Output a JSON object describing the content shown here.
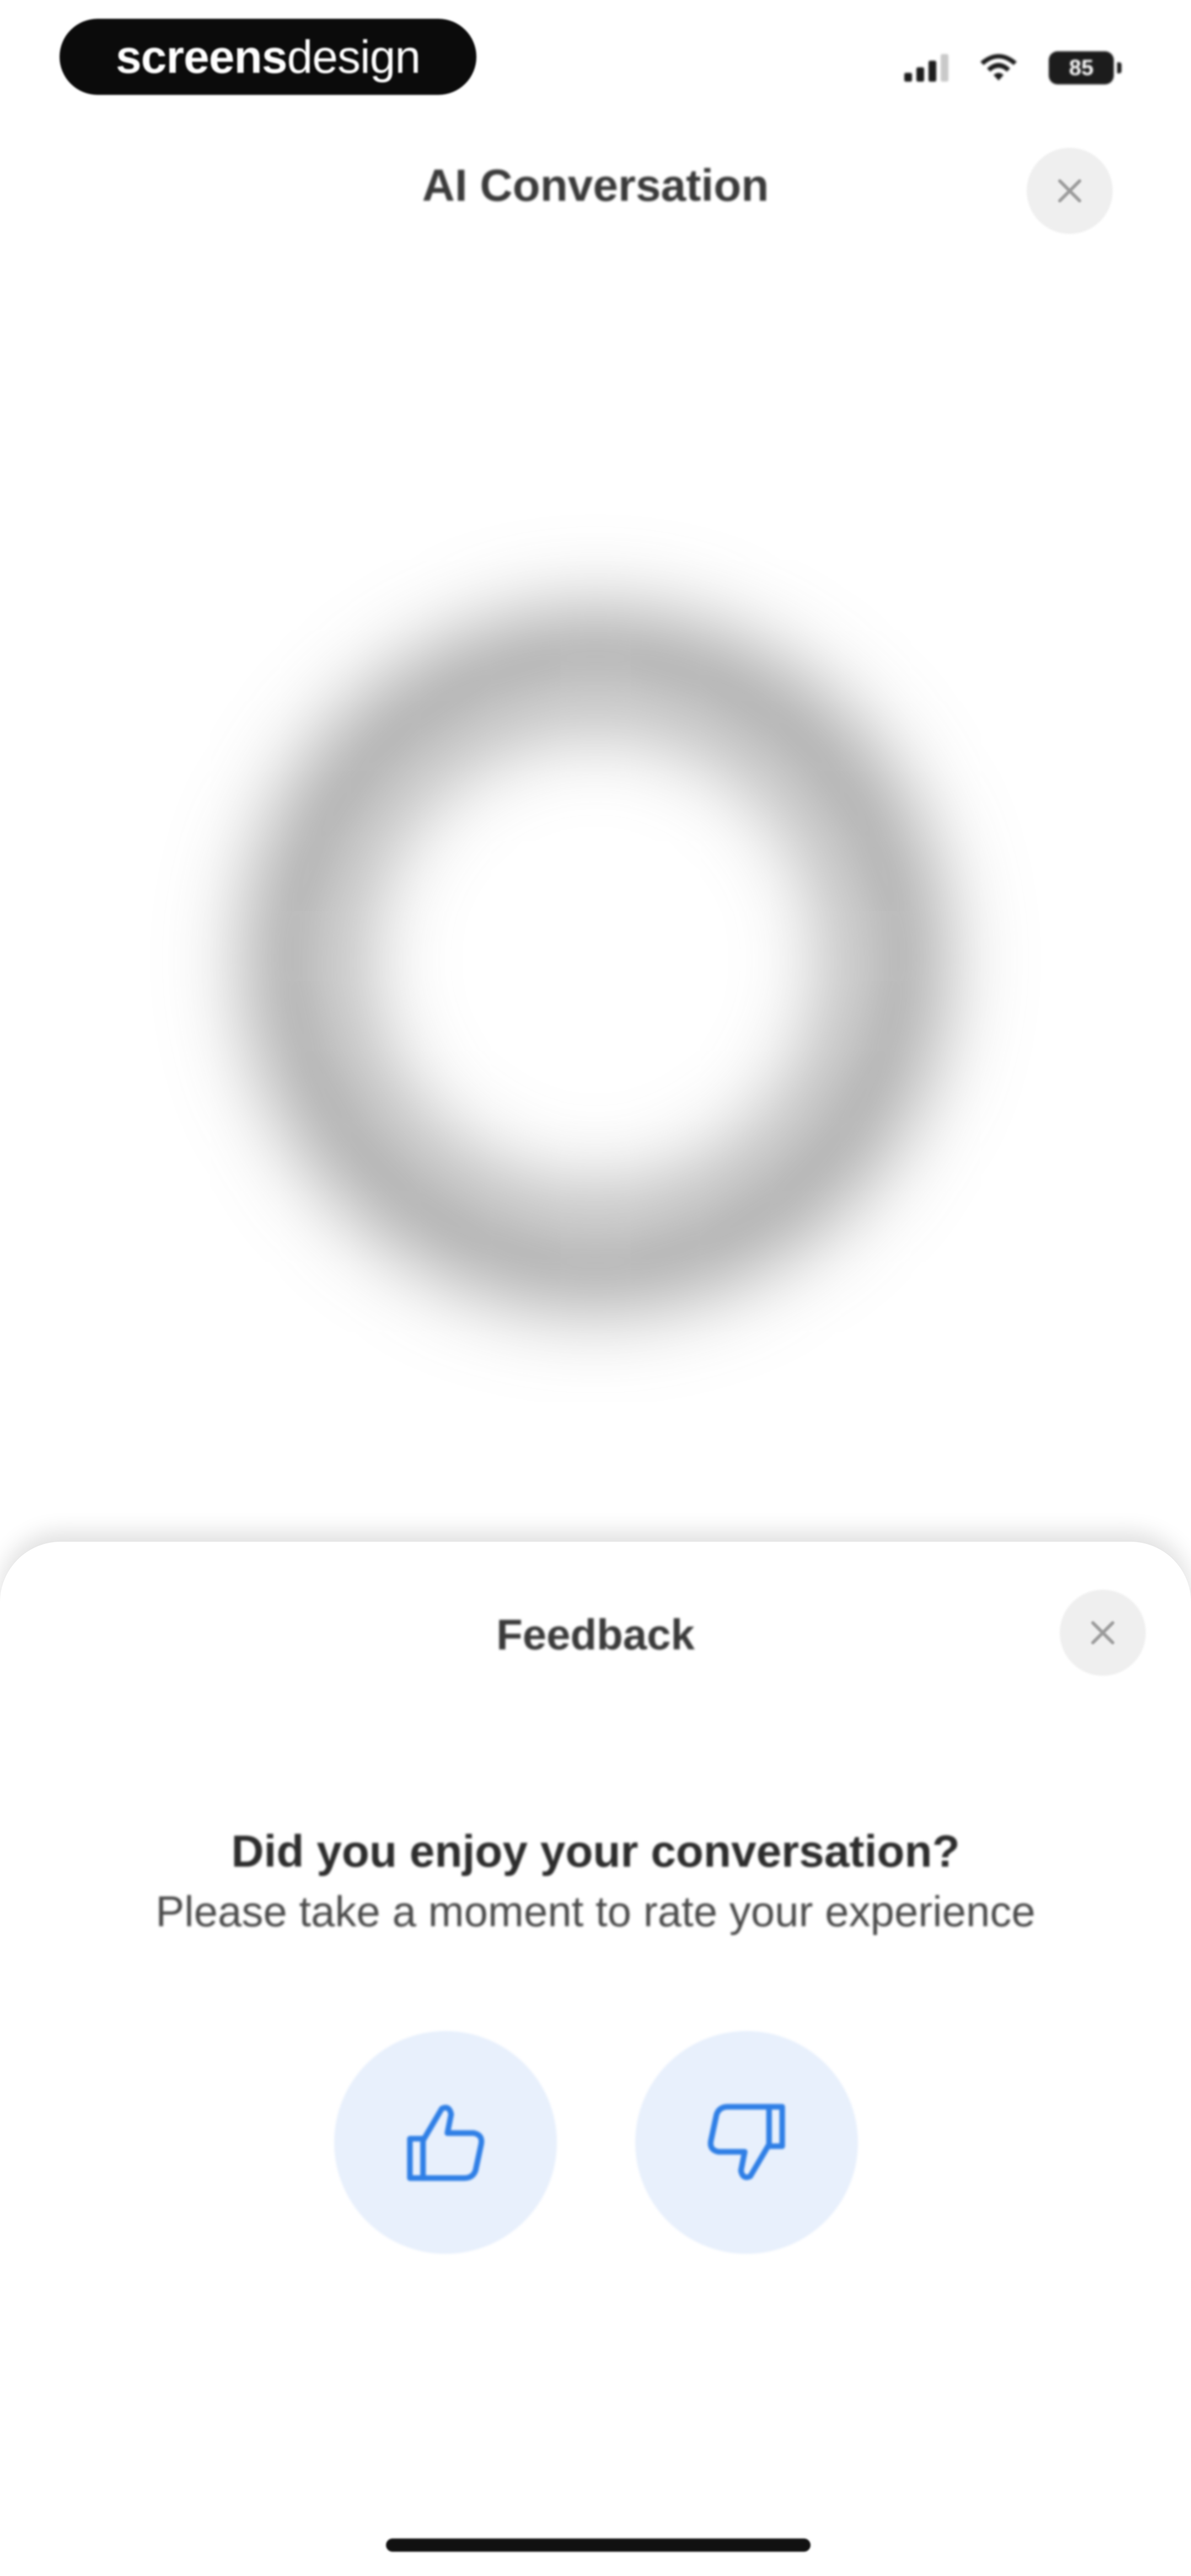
{
  "status_bar": {
    "brand_bold": "screens",
    "brand_light": "design",
    "battery_level": "85",
    "icons": [
      "signal-icon",
      "wifi-icon",
      "battery-icon"
    ]
  },
  "header": {
    "title": "AI Conversation",
    "close_icon": "close-icon"
  },
  "sheet": {
    "title": "Feedback",
    "question": "Did you enjoy your conversation?",
    "subtext": "Please take a moment to rate your experience",
    "thumbs_up_icon": "thumbs-up-icon",
    "thumbs_down_icon": "thumbs-down-icon"
  },
  "colors": {
    "accent": "#2f7fe6",
    "rating_button_bg": "#e8f0fc",
    "close_button_bg": "#efefef"
  }
}
